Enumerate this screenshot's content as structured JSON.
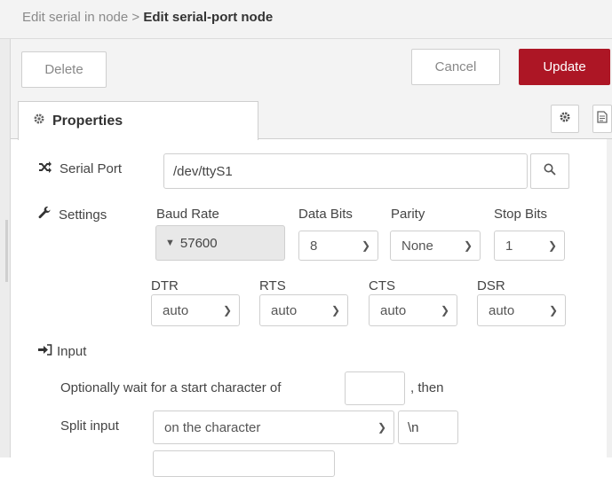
{
  "breadcrumb": {
    "parent": "Edit serial in node",
    "separator": ">",
    "current": "Edit serial-port node"
  },
  "toolbar": {
    "delete_label": "Delete",
    "cancel_label": "Cancel",
    "update_label": "Update",
    "accent": "#ad1625"
  },
  "tabs": {
    "properties_label": "Properties"
  },
  "serial_port": {
    "label": "Serial Port",
    "value": "/dev/ttyS1"
  },
  "settings": {
    "label": "Settings",
    "baud_rate": {
      "label": "Baud Rate",
      "value": "57600"
    },
    "data_bits": {
      "label": "Data Bits",
      "value": "8"
    },
    "parity": {
      "label": "Parity",
      "value": "None"
    },
    "stop_bits": {
      "label": "Stop Bits",
      "value": "1"
    },
    "dtr": {
      "label": "DTR",
      "value": "auto"
    },
    "rts": {
      "label": "RTS",
      "value": "auto"
    },
    "cts": {
      "label": "CTS",
      "value": "auto"
    },
    "dsr": {
      "label": "DSR",
      "value": "auto"
    }
  },
  "input": {
    "label": "Input",
    "start_char_prefix": "Optionally wait for a start character of",
    "start_char_value": "",
    "start_char_suffix": ", then",
    "split_label": "Split input",
    "split_value": "on the character",
    "split_char": "\\n"
  }
}
